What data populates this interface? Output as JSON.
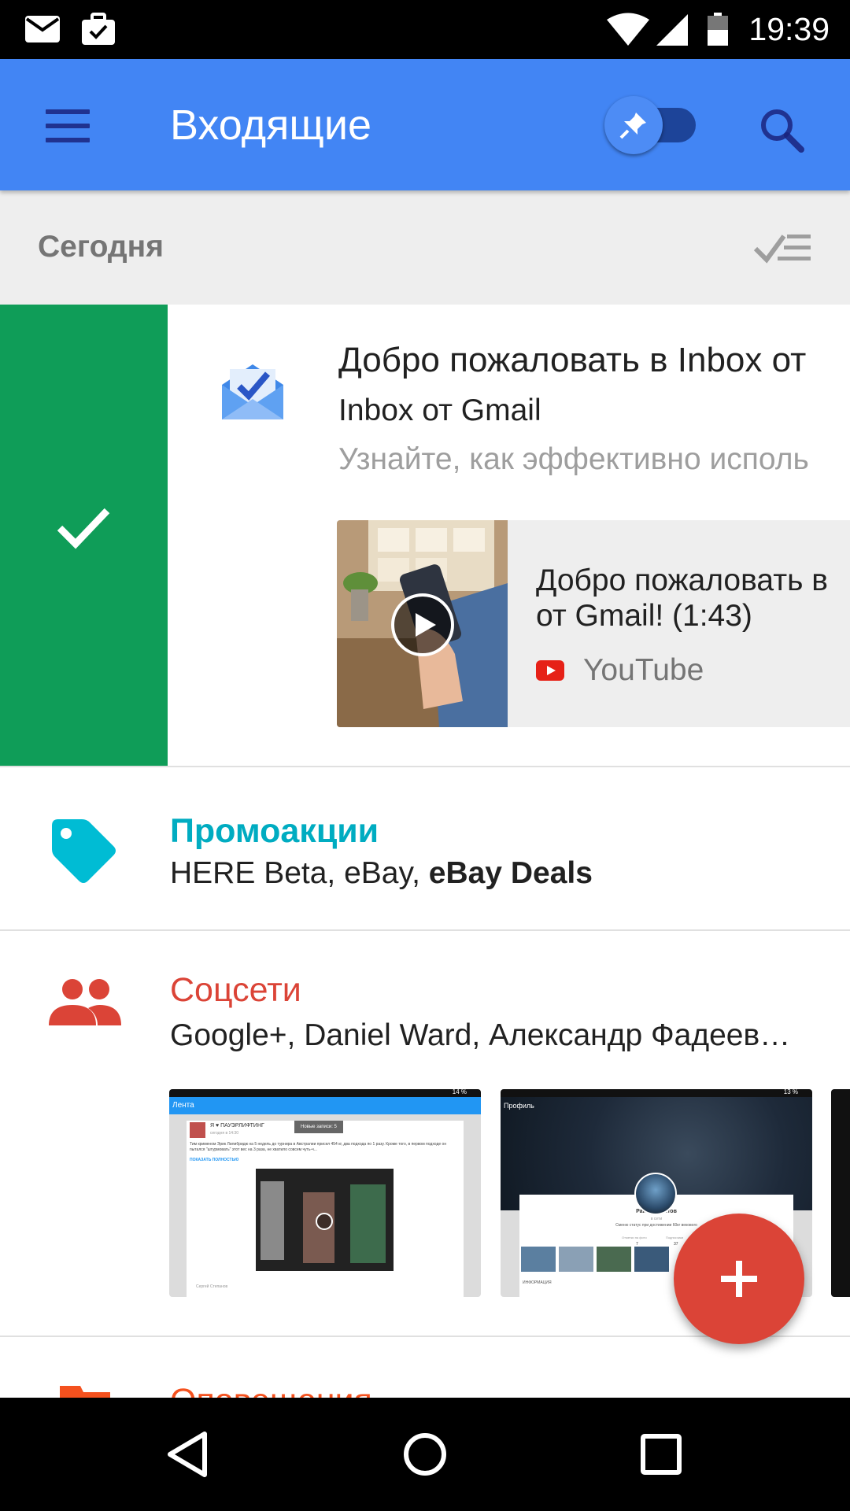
{
  "status_bar": {
    "time": "19:39",
    "icons": [
      "gmail-notification-icon",
      "work-briefcase-icon",
      "wifi-icon",
      "signal-icon",
      "battery-icon"
    ]
  },
  "app_bar": {
    "title": "Входящие",
    "menu_icon": "menu-icon",
    "pin_toggle_icon": "pin-icon",
    "search_icon": "search-icon",
    "color": "#4285f4"
  },
  "day_section": {
    "label": "Сегодня",
    "sweep_icon": "sweep-done-icon"
  },
  "welcome_item": {
    "subject": "Добро пожаловать в Inbox от",
    "sender": "Inbox от Gmail",
    "snippet": "Узнайте, как эффективно исполь",
    "swipe_action": "done-check-icon",
    "swipe_color": "#0f9d58",
    "attachment": {
      "title": "Добро пожаловать в\nот Gmail! (1:43)",
      "source": "YouTube",
      "play_icon": "play-icon"
    }
  },
  "bundles": {
    "promotions": {
      "title": "Промоакции",
      "senders_plain": "HERE Beta, eBay, ",
      "senders_bold": "eBay Deals",
      "icon": "tag-icon",
      "color": "#00acc1"
    },
    "social": {
      "title": "Соцсети",
      "senders": "Google+, Daniel Ward, Александр Фадеев…",
      "icon": "people-icon",
      "color": "#db4437",
      "previews": [
        {
          "header": "Лента",
          "status": "14 %",
          "post_title": "Я ♥ ПАУЭРЛИФТИНГ",
          "post_time": "сегодня в 14:30",
          "badge": "Новые записи: 5",
          "body": "Тим крименом Эрик Лилибридж на 5 недель до турнира в Австралии присел 454 кг, два подхода по 1 разу. Кроме того, в первом подходе он пытался \"штурмовать\" этот вес на 3 раза, не хватило совсем чуть-ч...",
          "link": "ПОКАЗАТЬ ПОЛНОСТЬЮ",
          "author": "Сергей Степанов"
        },
        {
          "header": "Профиль",
          "status": "13 %",
          "name": "Раиль Габитов",
          "presence": "в сети",
          "status_text": "Сменю статус при достижении 60кг векового",
          "stat1_label": "Отметки на фото",
          "stat1_value": "7",
          "stat2_label": "Подписчики",
          "stat2_value": "37",
          "section": "ИНФОРМАЦИЯ"
        }
      ]
    },
    "updates": {
      "title": "Оповещения",
      "icon": "flag-icon",
      "color": "#f4511e"
    }
  },
  "fab": {
    "icon": "plus-icon",
    "color": "#db4437"
  },
  "nav_bar": {
    "back_icon": "back-icon",
    "home_icon": "home-icon",
    "recents_icon": "recents-icon"
  }
}
